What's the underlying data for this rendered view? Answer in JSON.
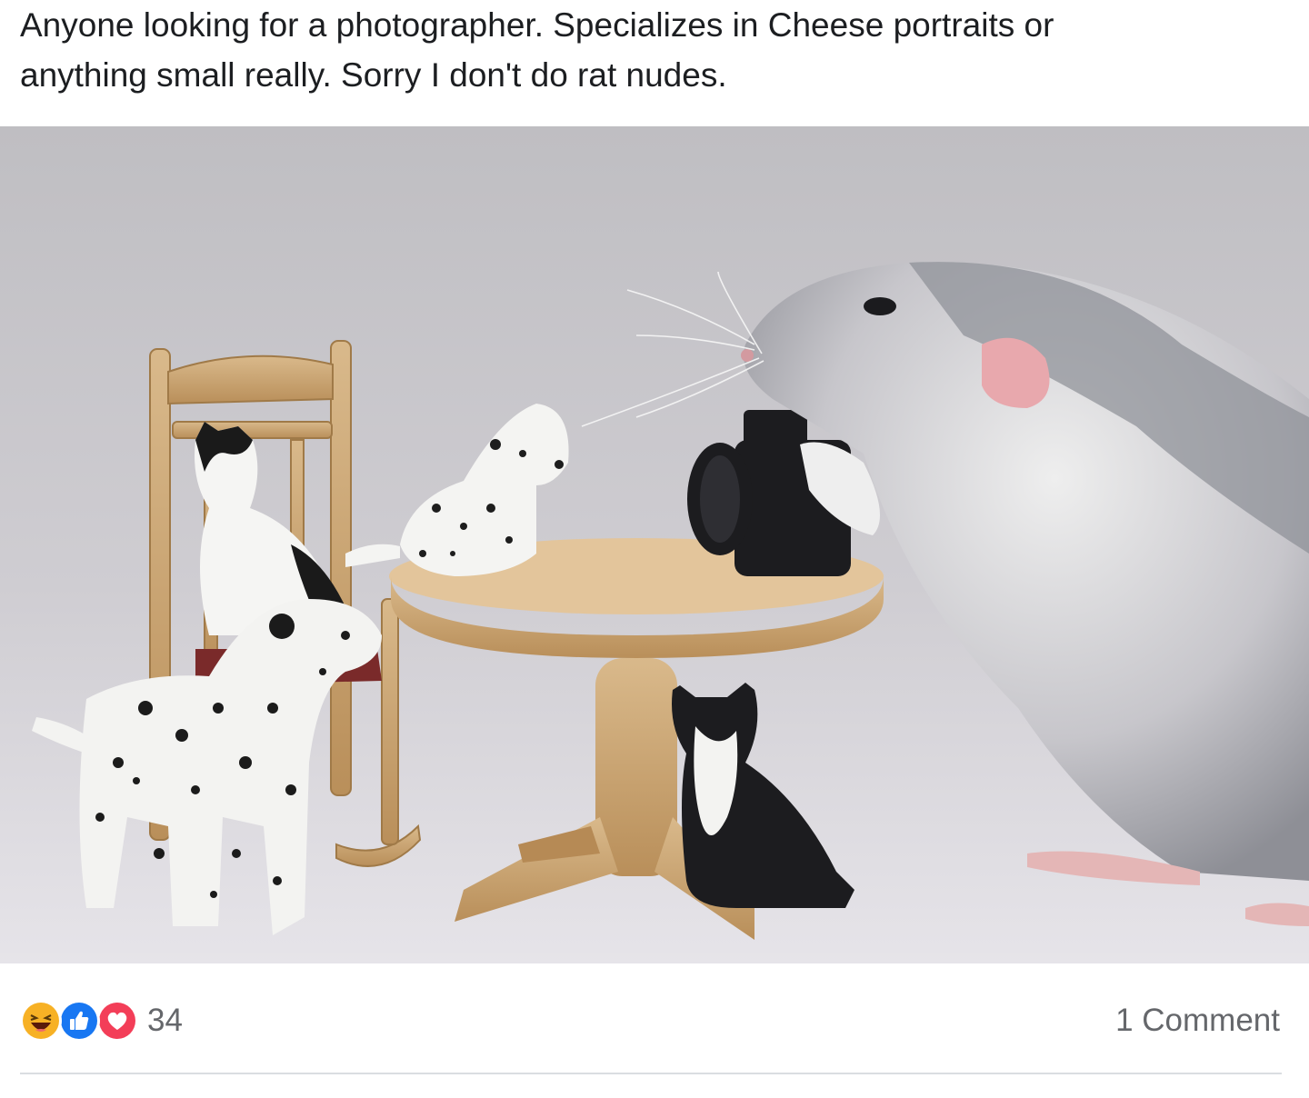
{
  "post": {
    "text_lines": [
      "Anyone looking for a photographer. Specializes in Cheese portraits or",
      "anything small really. Sorry I don't do rat nudes."
    ]
  },
  "reactions": {
    "icons": [
      "haha-icon",
      "like-icon",
      "love-icon"
    ],
    "count": "34"
  },
  "comments": {
    "label": "1 Comment"
  },
  "colors": {
    "like": "#1877f2",
    "love": "#f33e58",
    "haha": "#f7b125",
    "meta_text": "#65676b"
  }
}
